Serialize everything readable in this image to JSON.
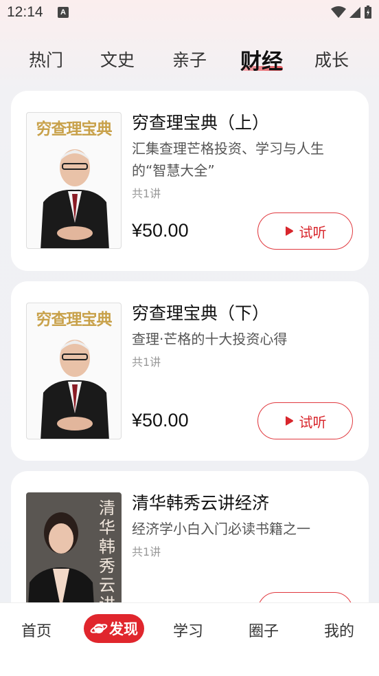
{
  "status_bar": {
    "time": "12:14",
    "notification_icon": "keyboard-a-icon",
    "icons": [
      "wifi-icon",
      "signal-icon",
      "battery-icon"
    ]
  },
  "tabs": [
    {
      "label": "热门",
      "active": false
    },
    {
      "label": "文史",
      "active": false
    },
    {
      "label": "亲子",
      "active": false
    },
    {
      "label": "财经",
      "active": true
    },
    {
      "label": "成长",
      "active": false
    }
  ],
  "courses": [
    {
      "cover_title": "穷查理宝典",
      "title": "穷查理宝典（上）",
      "description": "汇集查理芒格投资、学习与人生的“智慧大全”",
      "count": "共1讲",
      "price": "¥50.00",
      "button_label": "试听"
    },
    {
      "cover_title": "穷查理宝典",
      "title": "穷查理宝典（下）",
      "description": "查理·芒格的十大投资心得",
      "count": "共1讲",
      "price": "¥50.00",
      "button_label": "试听"
    },
    {
      "cover_title": "清华韩秀云讲经济",
      "title": "清华韩秀云讲经济",
      "description": "经济学小白入门必读书籍之一",
      "count": "共1讲"
    }
  ],
  "bottom_nav": [
    {
      "label": "首页",
      "active": false
    },
    {
      "label": "发现",
      "active": true
    },
    {
      "label": "学习",
      "active": false
    },
    {
      "label": "圈子",
      "active": false
    },
    {
      "label": "我的",
      "active": false
    }
  ],
  "colors": {
    "accent": "#e0262d",
    "cover_gold": "#c8a14a"
  }
}
